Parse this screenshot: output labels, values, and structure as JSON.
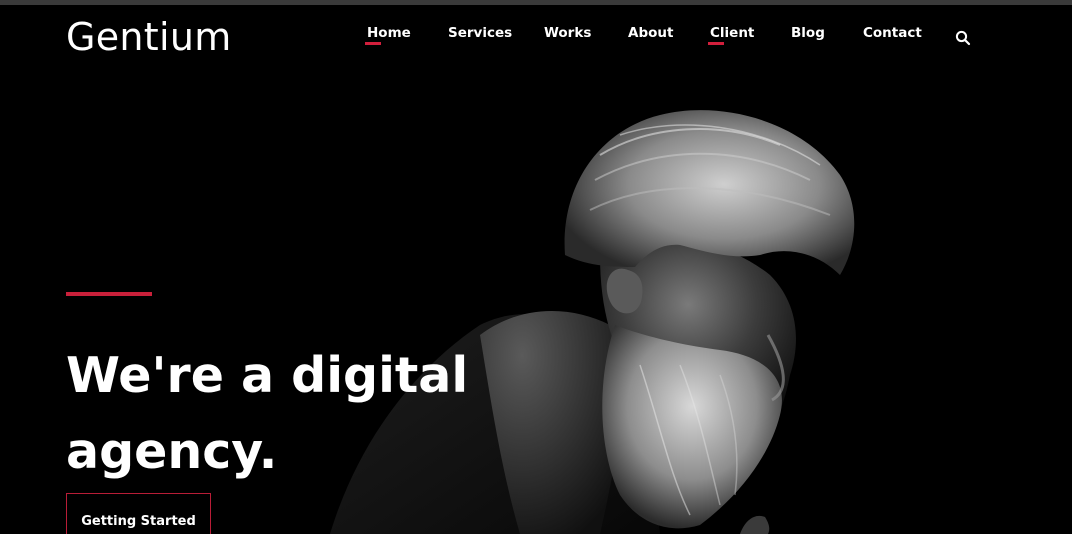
{
  "brand": {
    "logo_text": "Gentium"
  },
  "nav": {
    "items": [
      {
        "label": "Home",
        "active": true
      },
      {
        "label": "Services",
        "active": false
      },
      {
        "label": "Works",
        "active": false
      },
      {
        "label": "About",
        "active": false
      },
      {
        "label": "Client",
        "active": true
      },
      {
        "label": "Blog",
        "active": false
      },
      {
        "label": "Contact",
        "active": false
      }
    ],
    "search_icon": "search-icon"
  },
  "hero": {
    "headline_line1": "We're a digital",
    "headline_line2": "agency.",
    "cta_label": "Getting Started"
  },
  "colors": {
    "accent": "#d21f3c",
    "background": "#000000",
    "text": "#ffffff"
  }
}
